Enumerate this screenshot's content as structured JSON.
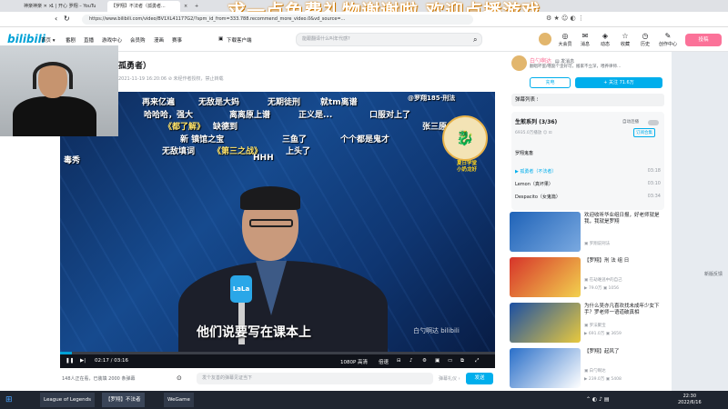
{
  "browser": {
    "tabs": [
      "神楽神楽 ✕ ×",
      "1 | 开心 罗翔 – YouTu",
      "【罗翔】不法者（孤勇者...",
      "×",
      "+"
    ],
    "url": "https://www.bilibili.com/video/BV1XL41177G2/?spm_id_from=333.788.recommend_more_video.0&vd_source=...",
    "overlay_text": "求一点免费礼物谢谢啦 欢迎点播游戏"
  },
  "header": {
    "logo": "bilibili",
    "nav": [
      "首页 ▾",
      "番剧",
      "直播",
      "游戏中心",
      "会员购",
      "漫画",
      "赛事",
      "▣",
      "下载客户端"
    ],
    "search_placeholder": "能跟翻译什么叫年代感?",
    "icons": [
      {
        "label": "大会员",
        "icon": "member-icon",
        "glyph": "◎"
      },
      {
        "label": "消息",
        "icon": "message-icon",
        "glyph": "✉"
      },
      {
        "label": "动态",
        "icon": "dynamic-icon",
        "glyph": "◈"
      },
      {
        "label": "收藏",
        "icon": "star-icon",
        "glyph": "☆"
      },
      {
        "label": "历史",
        "icon": "history-icon",
        "glyph": "◷"
      },
      {
        "label": "创作中心",
        "icon": "creator-icon",
        "glyph": "✎"
      }
    ],
    "upload": "投稿"
  },
  "video": {
    "title": "孤勇者）",
    "meta": "2021-11-19 16:20:06   ⊘ 未经作者授权，禁止转载",
    "subtitle": "他们说要写在课本上",
    "watermark": "白勺啊达 bilibili",
    "mic_label": "LaLa",
    "progress": 0.027,
    "time": "02:17 / 03:16",
    "quality": "1080P 高清",
    "speed": "倍速",
    "badge_text": "夏日学堂\n小奶龙好",
    "danmaku": [
      {
        "text": "再来亿遍",
        "color": "#ffffff"
      },
      {
        "text": "无敌是大妈",
        "color": "#ffffff"
      },
      {
        "text": "无期徒刑",
        "color": "#ffffff"
      },
      {
        "text": "就tm离谱",
        "color": "#ffffff"
      },
      {
        "text": "@罗翔185·刑法",
        "color": "#ffffff"
      },
      {
        "text": "哈哈哈，强大",
        "color": "#ffffff"
      },
      {
        "text": "离离原上谱",
        "color": "#ffffff"
      },
      {
        "text": "正义是...",
        "color": "#ffffff"
      },
      {
        "text": "口服对上了",
        "color": "#ffffff"
      },
      {
        "text": "《都了解》",
        "color": "#ffe36a"
      },
      {
        "text": "缺德到",
        "color": "#ffffff"
      },
      {
        "text": "张三原",
        "color": "#ffffff"
      },
      {
        "text": "新 镇馆之宝",
        "color": "#ffffff"
      },
      {
        "text": "三鱼了",
        "color": "#ffffff"
      },
      {
        "text": "个个都是鬼才",
        "color": "#ffffff"
      },
      {
        "text": "无敌填词",
        "color": "#ffffff"
      },
      {
        "text": "《第三之战》",
        "color": "#ffe36a"
      },
      {
        "text": "上头了",
        "color": "#ffffff"
      },
      {
        "text": "HHH",
        "color": "#ffffff"
      },
      {
        "text": "毒秀",
        "color": "#ffffff"
      }
    ]
  },
  "below": {
    "online": "148人正在看，已装填 2000 条弹幕",
    "input_placeholder": "发个友善的弹幕见证当下",
    "etiquette": "弹幕礼仪 ›",
    "send": "发送"
  },
  "sidebar": {
    "up_name": "白勺啊达",
    "up_tag": "▤ 发消息",
    "up_desc": "翻唱坏蛋/哦豁个歪好可，搬家不立深，喂养律师...",
    "charge": "充电",
    "follow": "+ 关注 71.6万",
    "danmaku_list": "弹幕列表 ⁝",
    "playlist_title": "生煎系列 (3/36)",
    "playlist_sub": "6935.0万播放  ☺ ⊡",
    "autoplay": "自动连播",
    "playlist_badge": "订阅合集",
    "group": "罗翔鬼畜",
    "items": [
      {
        "name": "▶ 孤勇者（不法者）",
        "time": "03:18"
      },
      {
        "name": "Lemon（真坏果）",
        "time": "03:10"
      },
      {
        "name": "Despacito（女鬼篇）",
        "time": "03:34"
      }
    ],
    "recs": [
      {
        "title": "欢迎收听华业组日报，好老师就是我，我就是罗翔",
        "author": "▣ 罗翔说刑法",
        "stats": "▶ 49.6万 ▣ 1432"
      },
      {
        "title": "【罗翔】刑 法 组 日",
        "author": "▣ 在劫难逃中的自己",
        "stats": "▶ 79.0万 ▣ 1056"
      },
      {
        "title": "为什么吴亦凡喜欢找未成年少女下手？罗老师一语道破真相",
        "author": "▣ 罗法聚宝",
        "stats": "▶ 691.0万 ▣ 3659"
      },
      {
        "title": "【罗翔】起风了",
        "author": "▣ 白勺啊达",
        "stats": "▶ 239.0万 ▣ 5408"
      }
    ]
  },
  "rightrail": "新版反馈",
  "taskbar": {
    "items": [
      "League of Legends",
      "【罗翔】不法者",
      "WeGame"
    ],
    "time": "22:30",
    "date": "2022/6/16"
  },
  "colors": {
    "accent": "#00aeec",
    "pink": "#fb7299"
  }
}
